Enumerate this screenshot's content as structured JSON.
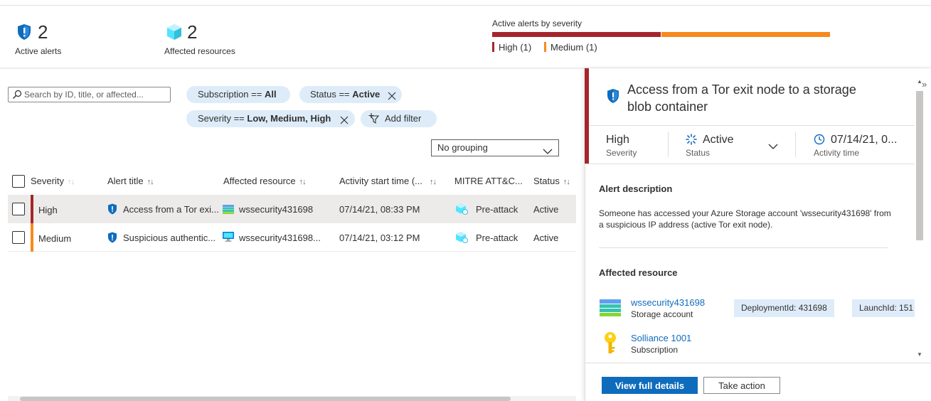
{
  "summary": {
    "active_alerts": {
      "count": "2",
      "label": "Active alerts",
      "icon": "shield-alert-icon"
    },
    "affected_resources": {
      "count": "2",
      "label": "Affected resources",
      "icon": "cube-icon"
    },
    "severity_chart": {
      "title": "Active alerts by severity",
      "legend": [
        {
          "label": "High (1)",
          "color": "#a4262c"
        },
        {
          "label": "Medium (1)",
          "color": "#f7891d"
        }
      ]
    }
  },
  "filters": {
    "search_placeholder": "Search by ID, title, or affected...",
    "subscription": {
      "prefix": "Subscription == ",
      "value": "All"
    },
    "status": {
      "prefix": "Status == ",
      "value": "Active"
    },
    "severity": {
      "prefix": "Severity == ",
      "value": "Low, Medium, High"
    },
    "add_filter": "Add filter",
    "grouping": "No grouping"
  },
  "table": {
    "columns": [
      "Severity",
      "Alert title",
      "Affected resource",
      "Activity start time (...",
      "MITRE ATT&C...",
      "Status"
    ],
    "rows": [
      {
        "severity": "High",
        "severity_color": "#a4262c",
        "title": "Access from a Tor exi...",
        "resource": "wssecurity431698",
        "resource_icon": "storage-account-icon",
        "start": "07/14/21, 08:33 PM",
        "mitre": "Pre-attack",
        "status": "Active"
      },
      {
        "severity": "Medium",
        "severity_color": "#f7891d",
        "title": "Suspicious authentic...",
        "resource": "wssecurity431698...",
        "resource_icon": "virtual-machine-icon",
        "start": "07/14/21, 03:12 PM",
        "mitre": "Pre-attack",
        "status": "Active"
      }
    ]
  },
  "details": {
    "title": "Access from a Tor exit node to a storage blob container",
    "severity": {
      "value": "High",
      "label": "Severity"
    },
    "status": {
      "value": "Active",
      "label": "Status"
    },
    "activity": {
      "value": "07/14/21, 0...",
      "label": "Activity time"
    },
    "description_title": "Alert description",
    "description": "Someone has accessed your Azure Storage account 'wssecurity431698' from a suspicious IP address (active Tor exit node).",
    "affected_title": "Affected resource",
    "resources": [
      {
        "name": "wssecurity431698",
        "type": "Storage account",
        "icon": "storage-account-icon"
      },
      {
        "name": "Solliance 1001",
        "type": "Subscription",
        "icon": "key-icon"
      }
    ],
    "tags": [
      "DeploymentId: 431698",
      "LaunchId: 151"
    ],
    "primary_button": "View full details",
    "secondary_button": "Take action"
  }
}
